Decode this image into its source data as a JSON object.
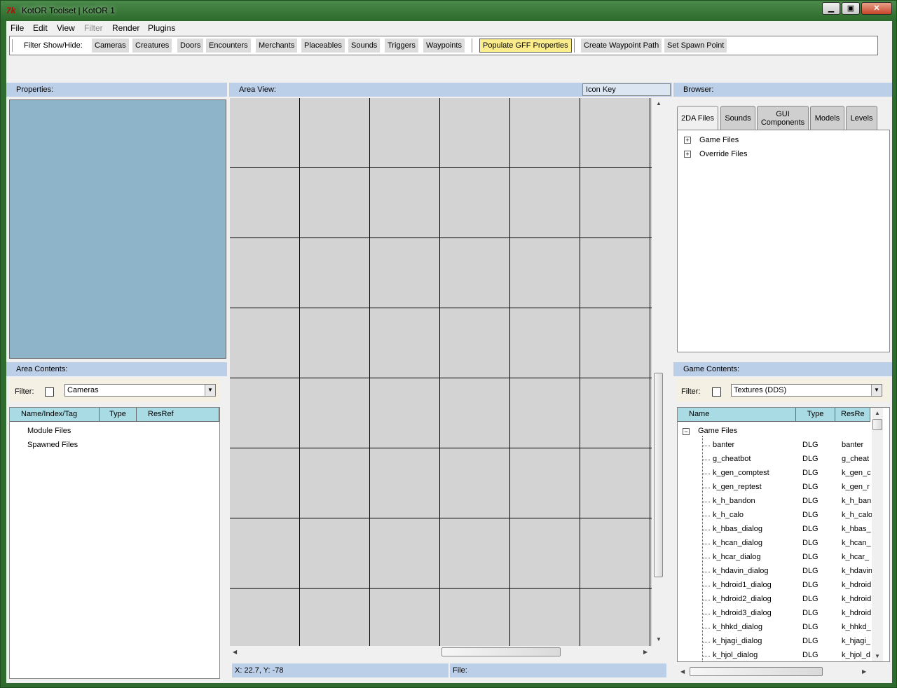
{
  "window": {
    "title": "KotOR Toolset | KotOR 1",
    "app_icon": "kt-logo-icon",
    "minimize": "▁",
    "maximize": "▣",
    "close": "✕"
  },
  "menu": {
    "file": "File",
    "edit": "Edit",
    "view": "View",
    "filter": "Filter",
    "render": "Render",
    "plugins": "Plugins"
  },
  "toolbar": {
    "label": "Filter Show/Hide:",
    "buttons": [
      "Cameras",
      "Creatures",
      "Doors",
      "Encounters",
      "Merchants",
      "Placeables",
      "Sounds",
      "Triggers",
      "Waypoints"
    ],
    "populate": "Populate GFF Properties",
    "waypoint_path": "Create Waypoint Path",
    "spawn_point": "Set Spawn Point"
  },
  "properties": {
    "title": "Properties:"
  },
  "area_view": {
    "title": "Area View:",
    "icon_key": "Icon Key"
  },
  "area_contents": {
    "title": "Area Contents:",
    "filter_label": "Filter:",
    "filter_value": "Cameras",
    "columns": [
      "Name/Index/Tag",
      "Type",
      "ResRef"
    ],
    "items": [
      "Module Files",
      "Spawned Files"
    ]
  },
  "browser": {
    "title": "Browser:",
    "tabs": [
      "2DA Files",
      "Sounds",
      "GUI Components",
      "Models",
      "Levels"
    ],
    "tree": [
      "Game Files",
      "Override Files"
    ]
  },
  "game_contents": {
    "title": "Game Contents:",
    "filter_label": "Filter:",
    "filter_value": "Textures (DDS)",
    "columns": [
      "Name",
      "Type",
      "ResRe"
    ],
    "root": "Game Files",
    "rows": [
      [
        "banter",
        "DLG",
        "banter"
      ],
      [
        "g_cheatbot",
        "DLG",
        "g_cheat"
      ],
      [
        "k_gen_comptest",
        "DLG",
        "k_gen_c"
      ],
      [
        "k_gen_reptest",
        "DLG",
        "k_gen_r"
      ],
      [
        "k_h_bandon",
        "DLG",
        "k_h_ban"
      ],
      [
        "k_h_calo",
        "DLG",
        "k_h_calo"
      ],
      [
        "k_hbas_dialog",
        "DLG",
        "k_hbas_"
      ],
      [
        "k_hcan_dialog",
        "DLG",
        "k_hcan_"
      ],
      [
        "k_hcar_dialog",
        "DLG",
        "k_hcar_"
      ],
      [
        "k_hdavin_dialog",
        "DLG",
        "k_hdavin"
      ],
      [
        "k_hdroid1_dialog",
        "DLG",
        "k_hdroid"
      ],
      [
        "k_hdroid2_dialog",
        "DLG",
        "k_hdroid"
      ],
      [
        "k_hdroid3_dialog",
        "DLG",
        "k_hdroid"
      ],
      [
        "k_hhkd_dialog",
        "DLG",
        "k_hhkd_"
      ],
      [
        "k_hjagi_dialog",
        "DLG",
        "k_hjagi_"
      ],
      [
        "k_hjol_dialog",
        "DLG",
        "k_hjol_d"
      ]
    ]
  },
  "status": {
    "coords": "X: 22.7, Y: -78",
    "file": "File:"
  }
}
